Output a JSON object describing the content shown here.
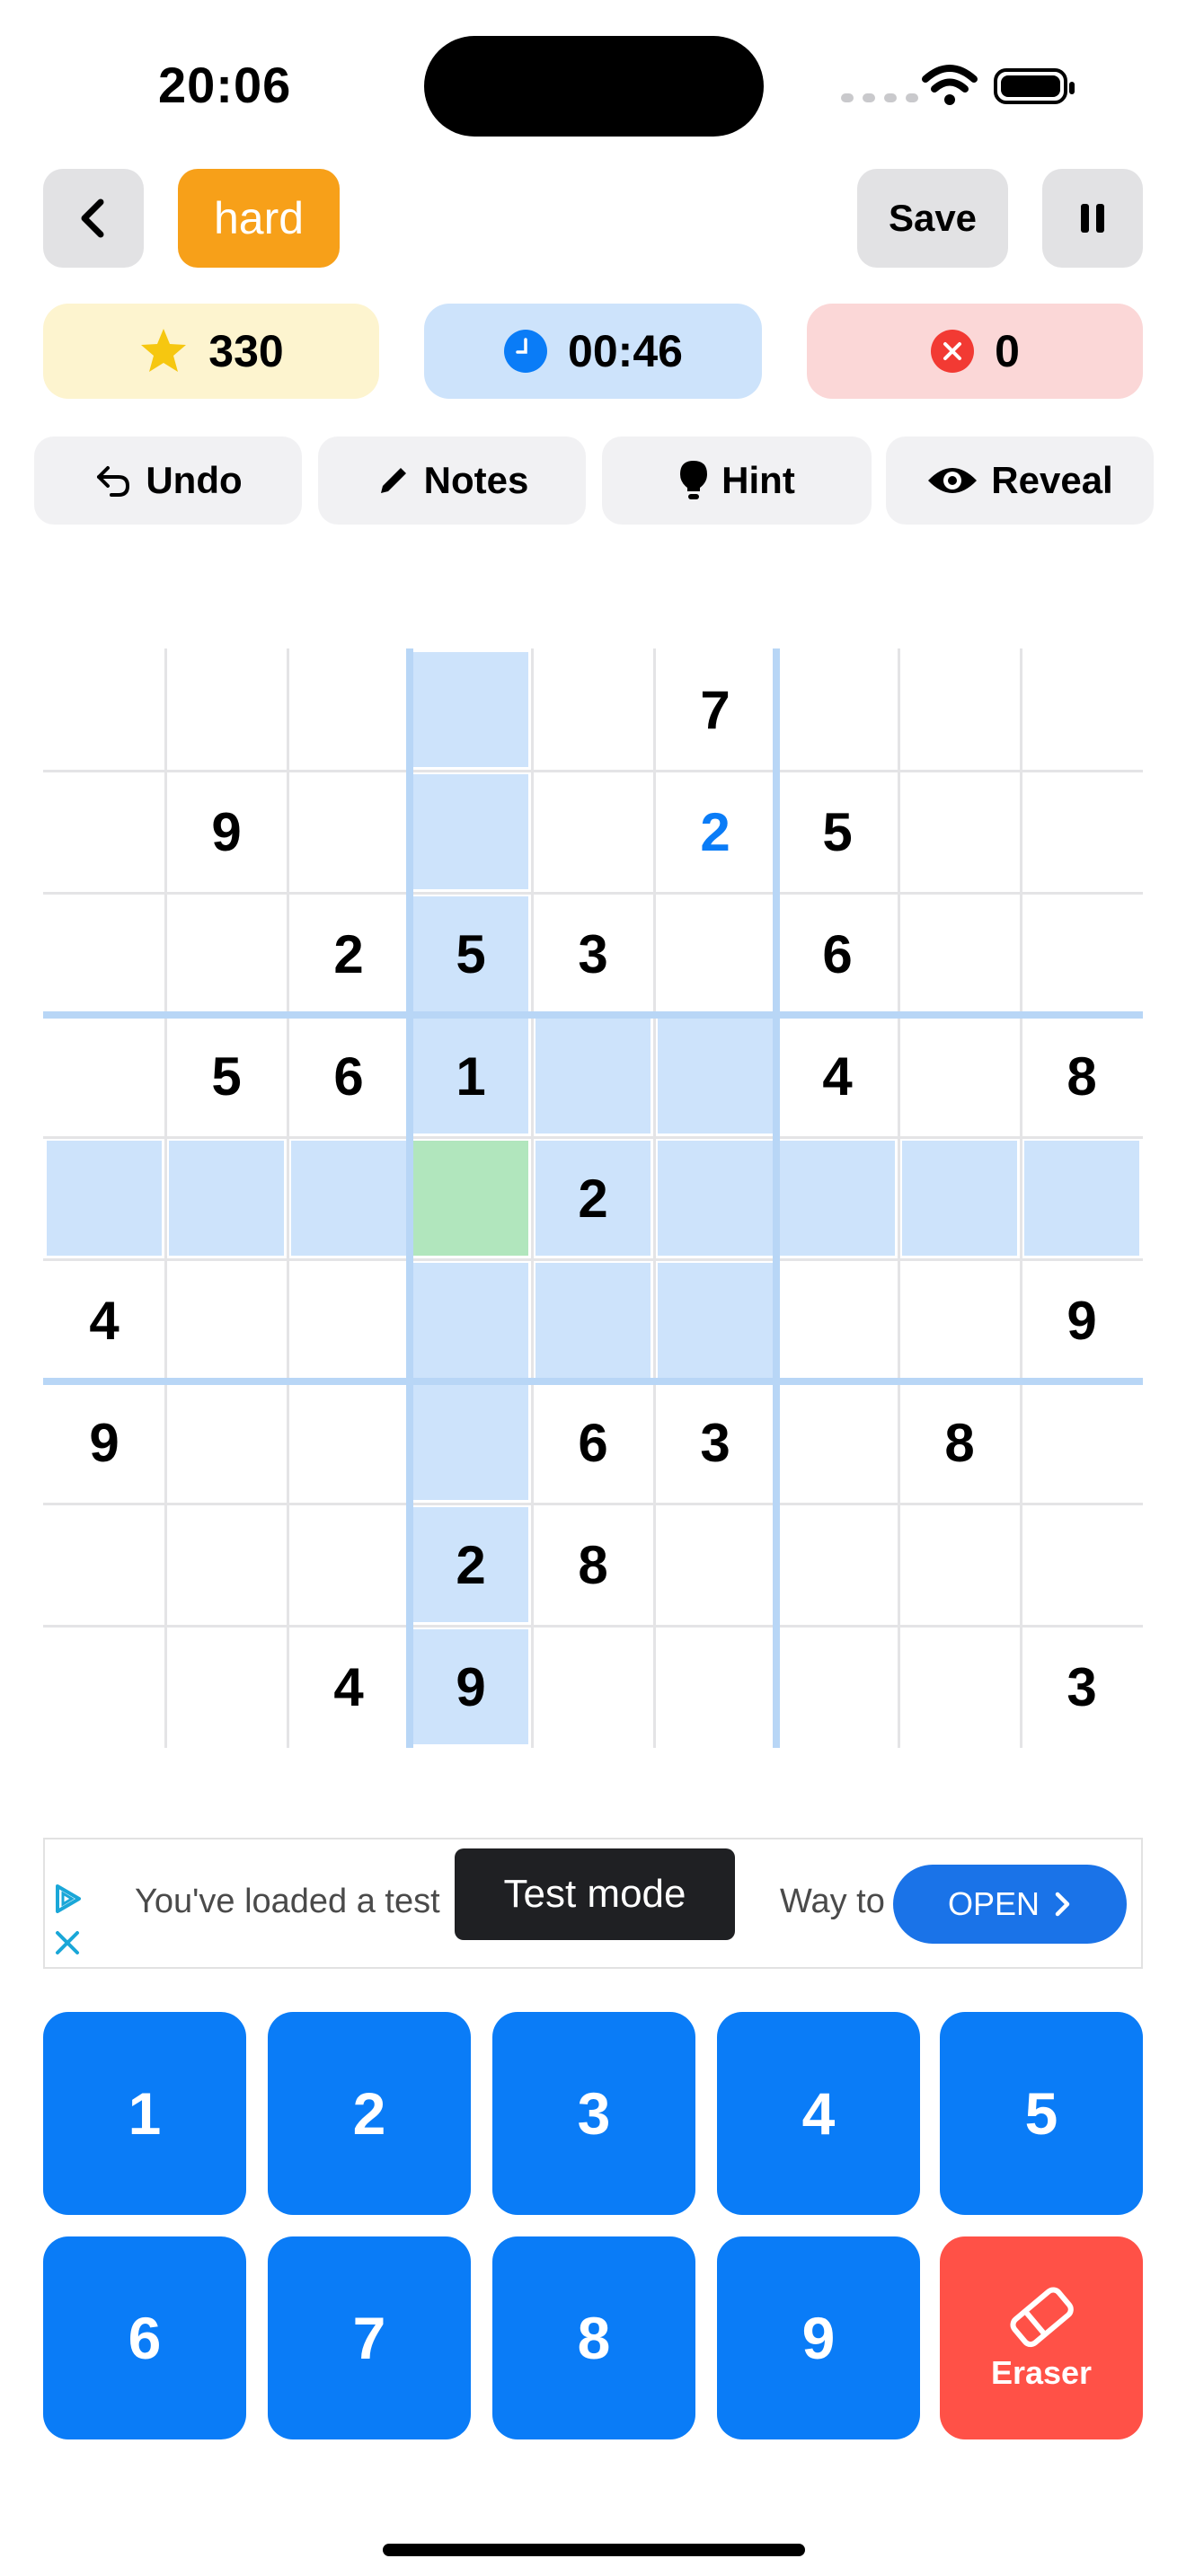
{
  "status_bar": {
    "time": "20:06"
  },
  "header": {
    "difficulty": "hard",
    "save_label": "Save"
  },
  "stats": {
    "score": "330",
    "timer": "00:46",
    "mistakes": "0"
  },
  "tools": {
    "undo": "Undo",
    "notes": "Notes",
    "hint": "Hint",
    "reveal": "Reveal"
  },
  "board": {
    "cells": [
      [
        "",
        "",
        "",
        "",
        "",
        "7",
        "",
        "",
        ""
      ],
      [
        "",
        "9",
        "",
        "",
        "",
        "2",
        "5",
        "",
        ""
      ],
      [
        "",
        "",
        "2",
        "5",
        "3",
        "",
        "6",
        "",
        ""
      ],
      [
        "",
        "5",
        "6",
        "1",
        "",
        "",
        "4",
        "",
        "8"
      ],
      [
        "",
        "",
        "",
        "",
        "2",
        "",
        "",
        "",
        ""
      ],
      [
        "4",
        "",
        "",
        "",
        "",
        "",
        "",
        "",
        "9"
      ],
      [
        "9",
        "",
        "",
        "",
        "6",
        "3",
        "",
        "8",
        ""
      ],
      [
        "",
        "",
        "",
        "2",
        "8",
        "",
        "",
        "",
        ""
      ],
      [
        "",
        "",
        "4",
        "9",
        "",
        "",
        "",
        "",
        "3"
      ]
    ],
    "selected": [
      4,
      3
    ],
    "user_entries": [
      [
        1,
        5
      ]
    ],
    "colors": {
      "highlight": "#cde3fb",
      "selected": "#b1e6bd",
      "given": "#000000",
      "user": "#0a7cf7"
    }
  },
  "ad": {
    "text_left": "You've loaded a test",
    "text_right": "Way to go!",
    "open_label": "OPEN",
    "toast": "Test mode"
  },
  "keypad": {
    "keys": [
      "1",
      "2",
      "3",
      "4",
      "5",
      "6",
      "7",
      "8",
      "9"
    ],
    "eraser_label": "Eraser"
  },
  "colors": {
    "accent": "#0a7cf7",
    "difficulty": "#f7a019",
    "eraser": "#ff5147"
  }
}
